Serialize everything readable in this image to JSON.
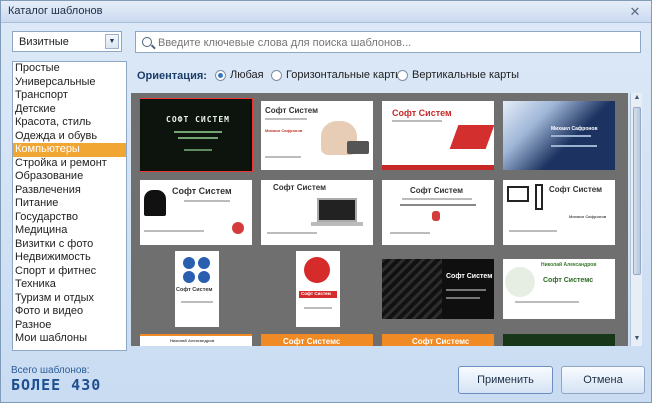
{
  "window": {
    "title": "Каталог шаблонов"
  },
  "filter": {
    "type_select": "Визитные"
  },
  "search": {
    "placeholder": "Введите ключевые слова для поиска шаблонов..."
  },
  "orientation": {
    "label": "Ориентация:",
    "options": [
      "Любая",
      "Горизонтальные карты",
      "Вертикальные карты"
    ],
    "selected": "Любая"
  },
  "categories": [
    "Простые",
    "Универсальные",
    "Транспорт",
    "Детские",
    "Красота, стиль",
    "Одежда и обувь",
    "Компьютеры",
    "Стройка и ремонт",
    "Образование",
    "Развлечения",
    "Питание",
    "Государство",
    "Медицина",
    "Визитки с фото",
    "Недвижимость",
    "Спорт и фитнес",
    "Техника",
    "Туризм и отдых",
    "Фото и видео",
    "Разное",
    "Мои шаблоны"
  ],
  "selected_category": "Компьютеры",
  "templates": {
    "card1_title": "СОФТ СИСТЕМ",
    "card2_title": "Софт Систем",
    "card2_name": "Михаил Сафронов",
    "card3_title": "Софт Систем",
    "card4_name": "Михаил Сафронов",
    "card5_title": "Софт Систем",
    "card6_title": "Софт Систем",
    "card7_title": "Софт Систем",
    "card8_title": "Софт Систем",
    "card8_name": "Михаил Сафронов",
    "card9_title": "Софт Систем",
    "card10_title": "Софт Систем",
    "card11_title": "Софт Систем",
    "card12_name": "Николай Александров",
    "card12_title": "Софт Системс",
    "card13_name": "Николай Александров",
    "card14_title": "Софт Системс",
    "card15_title": "Софт Системс"
  },
  "footer": {
    "total_label": "Всего шаблонов:",
    "total_value": "БОЛЕЕ 430",
    "apply": "Применить",
    "cancel": "Отмена"
  },
  "colors": {
    "accent": "#f1a533",
    "red": "#d32f2f",
    "orange": "#f08a24"
  }
}
